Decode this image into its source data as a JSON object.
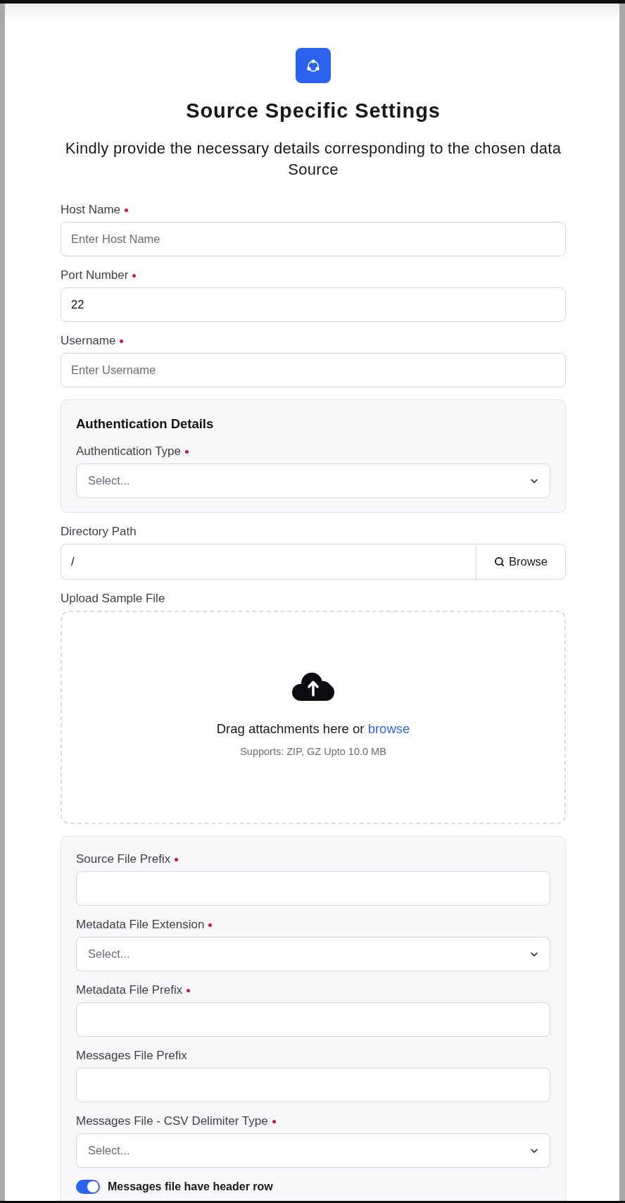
{
  "header": {
    "title": "Source Specific Settings",
    "subtitle": "Kindly provide the necessary details corresponding to the chosen data Source"
  },
  "fields": [
    {
      "kind": "text",
      "label": "Host Name",
      "required": true,
      "placeholder": "Enter Host Name"
    },
    {
      "kind": "text",
      "label": "Port Number",
      "required": true,
      "value": "22"
    },
    {
      "kind": "text",
      "label": "Username",
      "required": true,
      "placeholder": "Enter Username"
    },
    {
      "kind": "group",
      "title": "Authentication Details",
      "fields": [
        {
          "kind": "select",
          "label": "Authentication Type",
          "required": true,
          "placeholder": "Select..."
        }
      ]
    },
    {
      "kind": "browse",
      "label": "Directory Path",
      "required": false,
      "value": "/",
      "button": "Browse"
    },
    {
      "kind": "upload",
      "label": "Upload Sample File",
      "required": false,
      "prompt": "Drag attachments here or",
      "link": "browse",
      "hint": "Supports: ZIP, GZ Upto 10.0 MB"
    },
    {
      "kind": "group",
      "fields": [
        {
          "kind": "text",
          "label": "Source File Prefix",
          "required": true
        },
        {
          "kind": "select",
          "label": "Metadata File Extension",
          "required": true,
          "placeholder": "Select..."
        },
        {
          "kind": "text",
          "label": "Metadata File Prefix",
          "required": true
        },
        {
          "kind": "text",
          "label": "Messages File Prefix",
          "required": false
        },
        {
          "kind": "select",
          "label": "Messages File - CSV Delimiter Type",
          "required": true,
          "placeholder": "Select..."
        },
        {
          "kind": "toggle",
          "label": "Messages file have header row",
          "on": true
        }
      ]
    }
  ]
}
